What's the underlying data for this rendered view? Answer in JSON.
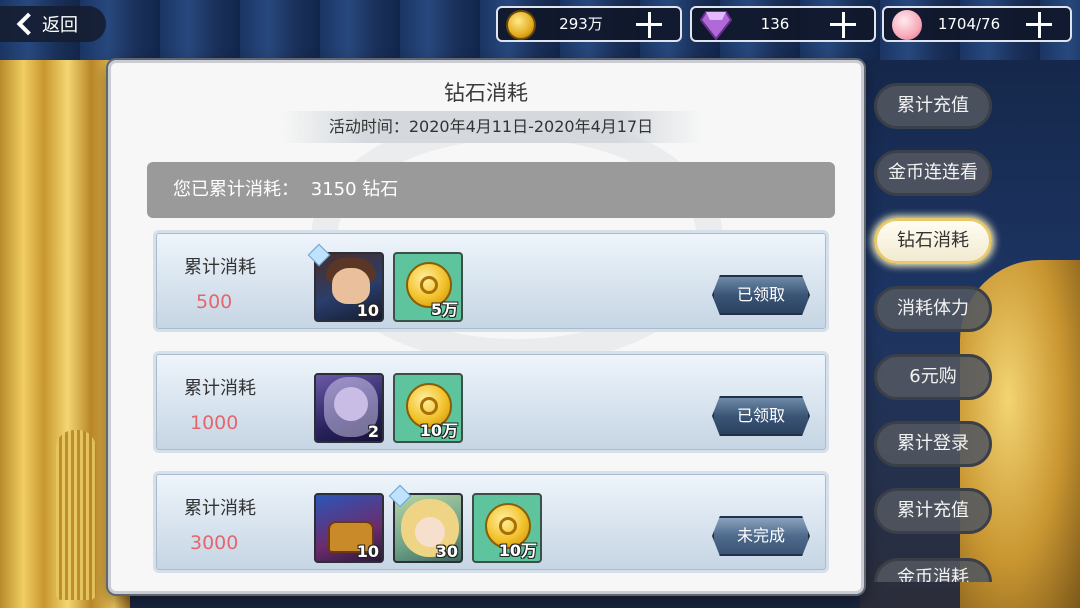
{
  "header": {
    "back_label": "返回",
    "resources": [
      {
        "icon": "gold-coin-icon",
        "value": "293万"
      },
      {
        "icon": "diamond-icon",
        "value": "136"
      },
      {
        "icon": "peach-stamina-icon",
        "value": "1704/76"
      }
    ]
  },
  "panel": {
    "title": "钻石消耗",
    "event_time": "活动时间：2020年4月11日-2020年4月17日",
    "summary_label": "您已累计消耗：",
    "summary_value": "3150 钻石",
    "rows": [
      {
        "label": "累计消耗",
        "amount": "500",
        "rewards": [
          {
            "icon": "hero-portrait-icon",
            "count": "10"
          },
          {
            "icon": "gold-coin-icon",
            "count": "5万"
          }
        ],
        "button": "已领取"
      },
      {
        "label": "累计消耗",
        "amount": "1000",
        "rewards": [
          {
            "icon": "hero-portrait-icon",
            "count": "2"
          },
          {
            "icon": "gold-coin-icon",
            "count": "10万"
          }
        ],
        "button": "已领取"
      },
      {
        "label": "累计消耗",
        "amount": "3000",
        "rewards": [
          {
            "icon": "treasure-chest-icon",
            "count": "10"
          },
          {
            "icon": "hero-portrait-icon",
            "count": "30"
          },
          {
            "icon": "gold-coin-icon",
            "count": "10万"
          }
        ],
        "button": "未完成"
      }
    ]
  },
  "sidebar": {
    "tabs": [
      {
        "label": "累计充值",
        "active": false
      },
      {
        "label": "金币连连看",
        "active": false
      },
      {
        "label": "钻石消耗",
        "active": true
      },
      {
        "label": "消耗体力",
        "active": false
      },
      {
        "label": "6元购",
        "active": false
      },
      {
        "label": "累计登录",
        "active": false
      },
      {
        "label": "累计充值",
        "active": false
      },
      {
        "label": "金币消耗",
        "active": false
      }
    ]
  }
}
